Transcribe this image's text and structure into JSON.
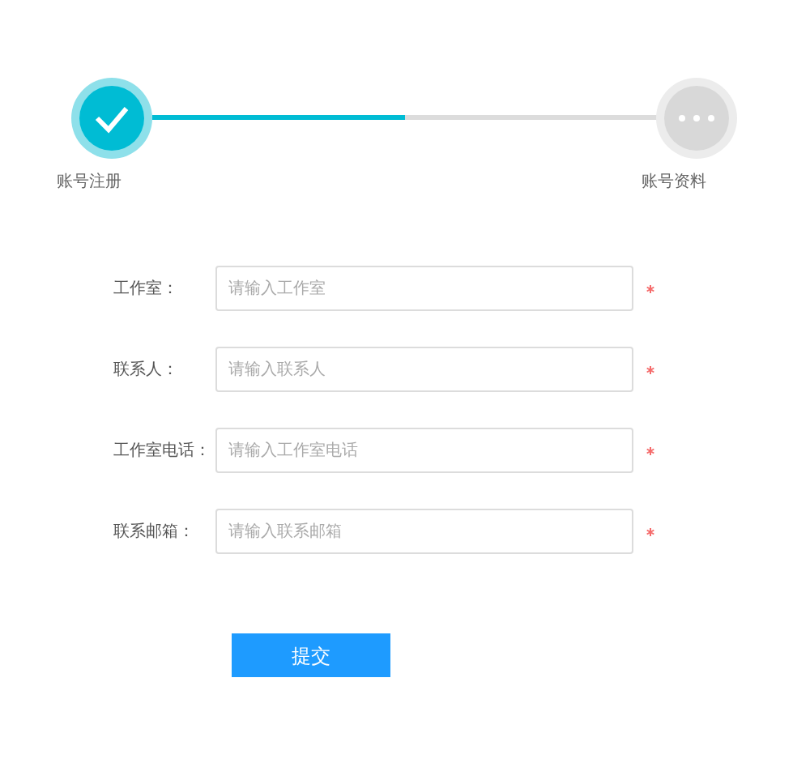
{
  "steps": [
    {
      "label": "账号注册",
      "done": true
    },
    {
      "label": "账号资料",
      "done": false
    }
  ],
  "progress": {
    "level": 0.5
  },
  "fields": [
    {
      "label": "工作室：",
      "placeholder": "请输入工作室",
      "required": true
    },
    {
      "label": "联系人：",
      "placeholder": "请输入联系人",
      "required": true
    },
    {
      "label": "工作室电话：",
      "placeholder": "请输入工作室电话",
      "required": true
    },
    {
      "label": "联系邮箱：",
      "placeholder": "请输入联系邮箱",
      "required": true
    }
  ],
  "submit": "提交"
}
